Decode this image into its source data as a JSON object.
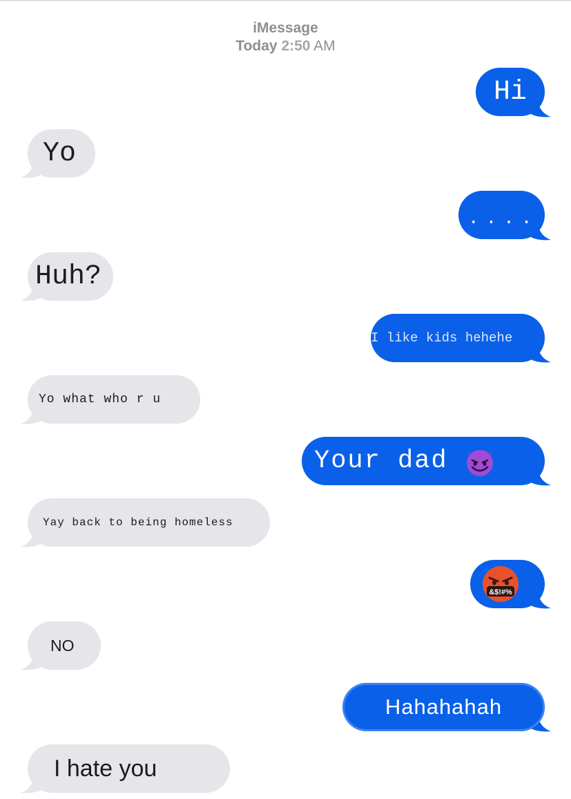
{
  "header": {
    "service": "iMessage",
    "day": "Today",
    "time": "2:50",
    "meridiem": "AM"
  },
  "messages": [
    {
      "from": "me",
      "text": "Hi"
    },
    {
      "from": "them",
      "text": "Yo"
    },
    {
      "from": "me",
      "text": "...."
    },
    {
      "from": "them",
      "text": "Huh?"
    },
    {
      "from": "me",
      "text": "I like kids hehehe"
    },
    {
      "from": "them",
      "text": "Yo what who r u"
    },
    {
      "from": "me",
      "text": "Your dad",
      "emoji": "smiling-imp-emoji"
    },
    {
      "from": "them",
      "text": "Yay back to being homeless"
    },
    {
      "from": "me",
      "emoji": "face-with-symbols-on-mouth-emoji",
      "emoji_text": "&$!#%"
    },
    {
      "from": "them",
      "text": "NO"
    },
    {
      "from": "me",
      "text": "Hahahahah"
    },
    {
      "from": "them",
      "text": "I hate you"
    }
  ],
  "colors": {
    "sent_bubble": "#0a60e8",
    "received_bubble": "#e5e5ea",
    "timestamp": "#8e8e93"
  }
}
